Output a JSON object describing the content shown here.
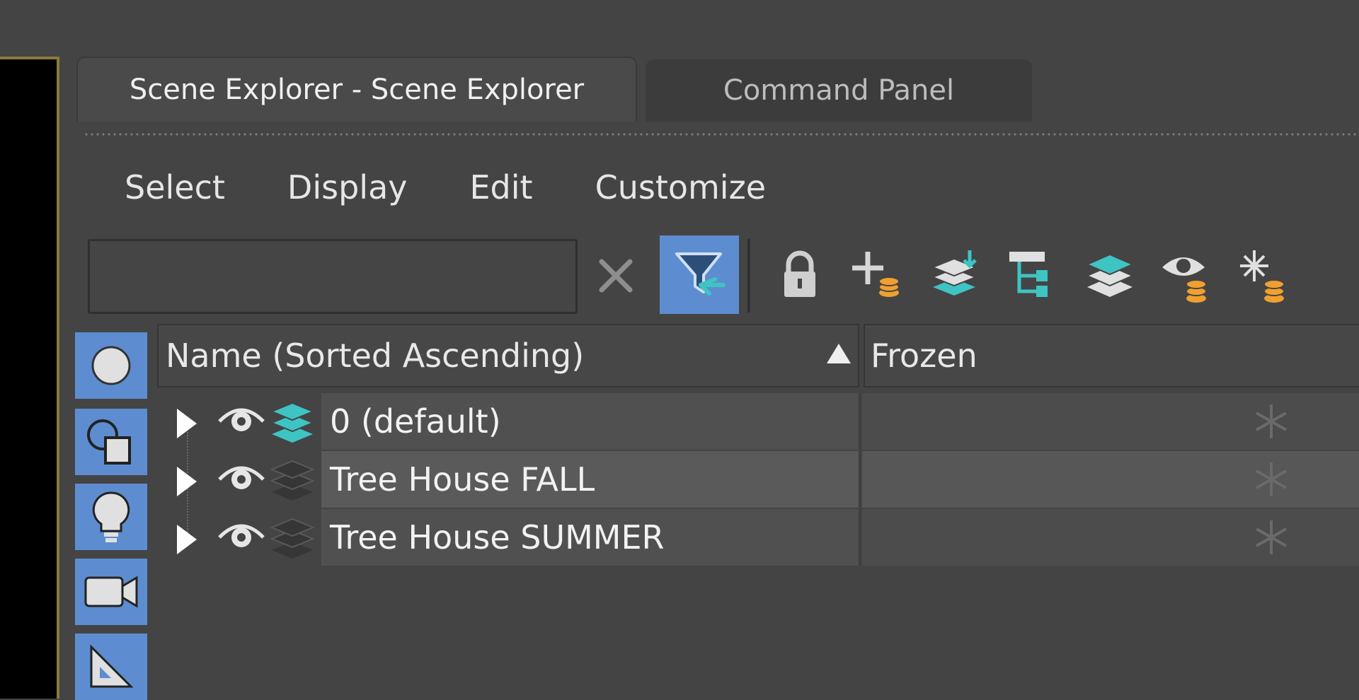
{
  "tabs": [
    {
      "label": "Scene Explorer - Scene Explorer",
      "active": true
    },
    {
      "label": "Command Panel",
      "active": false
    }
  ],
  "menu": [
    "Select",
    "Display",
    "Edit",
    "Customize"
  ],
  "search": {
    "value": "",
    "placeholder": ""
  },
  "toolbar": {
    "clear_icon": "close-icon",
    "filter_icon": "filter-selection-icon",
    "tools": [
      "lock-icon",
      "create-layer-icon",
      "add-to-layer-icon",
      "hierarchy-icon",
      "layers-icon",
      "hide-layer-icon",
      "freeze-layer-icon"
    ]
  },
  "side_filters": [
    "geometry-icon",
    "shapes-icon",
    "lights-icon",
    "cameras-icon",
    "helpers-icon"
  ],
  "columns": {
    "name": "Name (Sorted Ascending)",
    "frozen": "Frozen"
  },
  "rows": [
    {
      "name": "0 (default)",
      "active": true
    },
    {
      "name": "Tree House FALL",
      "active": false
    },
    {
      "name": "Tree House SUMMER",
      "active": false
    }
  ],
  "colors": {
    "accent": "#5d8dd0",
    "teal": "#3fc4c4",
    "orange": "#f0a030",
    "row_bg": "#505050",
    "row_alt_bg": "#5a5a5a"
  }
}
